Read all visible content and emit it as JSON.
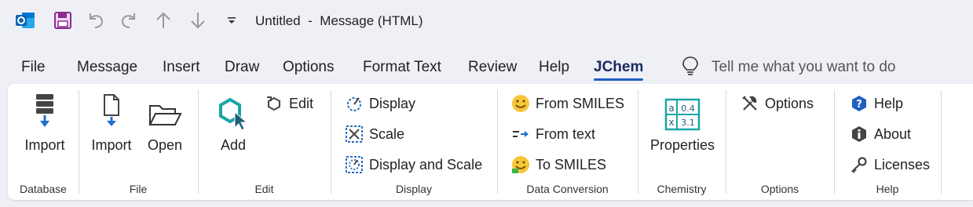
{
  "window": {
    "title": "Untitled  -  Message (HTML)"
  },
  "quick_access": {
    "app_icon": "outlook-icon",
    "icons": [
      "save-icon",
      "undo-icon",
      "redo-icon",
      "up-arrow-icon",
      "down-arrow-icon",
      "customize-dropdown-icon"
    ]
  },
  "tabs": [
    {
      "label": "File"
    },
    {
      "label": "Message"
    },
    {
      "label": "Insert"
    },
    {
      "label": "Draw"
    },
    {
      "label": "Options"
    },
    {
      "label": "Format Text"
    },
    {
      "label": "Review"
    },
    {
      "label": "Help"
    },
    {
      "label": "JChem"
    }
  ],
  "active_tab": "JChem",
  "tellme": {
    "text": "Tell me what you want to do",
    "icon": "lightbulb-icon"
  },
  "ribbon": {
    "database": {
      "label": "Database",
      "import": "Import"
    },
    "file": {
      "label": "File",
      "import": "Import",
      "open": "Open"
    },
    "edit": {
      "label": "Edit",
      "add": "Add",
      "edit": "Edit"
    },
    "display": {
      "label": "Display",
      "display": "Display",
      "scale": "Scale",
      "display_and_scale": "Display and Scale"
    },
    "conversion": {
      "label": "Data Conversion",
      "from_smiles": "From SMILES",
      "from_text": "From text",
      "to_smiles": "To SMILES"
    },
    "chemistry": {
      "label": "Chemistry",
      "properties": "Properties",
      "icon_cells": [
        "a",
        "0.4",
        "x",
        "3.1"
      ]
    },
    "options": {
      "label": "Options",
      "options": "Options"
    },
    "help": {
      "label": "Help",
      "help": "Help",
      "about": "About",
      "licenses": "Licenses"
    }
  },
  "colors": {
    "accent": "#1f5fc2",
    "save_purple": "#8b2c8f",
    "teal": "#1aa5a5",
    "ribbon_bg": "#ffffff",
    "window_bg": "#eef0f6"
  }
}
